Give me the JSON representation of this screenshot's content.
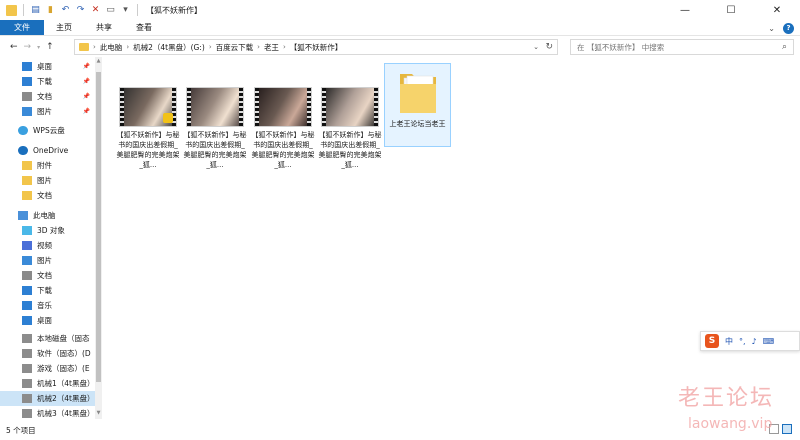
{
  "window": {
    "title": "【狐不妖新作】",
    "controls": {
      "minimize": "—",
      "maximize": "☐",
      "close": "✕"
    }
  },
  "ribbon": {
    "tabs": [
      "文件",
      "主页",
      "共享",
      "查看"
    ],
    "file_color": "#1a6fbd"
  },
  "address": {
    "crumbs": [
      "此电脑",
      "机械2（4t黑盘）(G:)",
      "百度云下载",
      "老王",
      "【狐不妖新作】"
    ],
    "search_placeholder": "在 【狐不妖新作】 中搜索"
  },
  "sidebar": {
    "items": [
      {
        "label": "桌面",
        "icon": "desktop-icon",
        "pinned": true
      },
      {
        "label": "下载",
        "icon": "download-icon",
        "pinned": true
      },
      {
        "label": "文档",
        "icon": "documents-icon",
        "pinned": true
      },
      {
        "label": "图片",
        "icon": "pictures-icon",
        "pinned": true
      },
      {
        "label": "WPS云盘",
        "icon": "cloud-icon"
      },
      {
        "label": "OneDrive",
        "icon": "onedrive-icon"
      },
      {
        "label": "附件",
        "icon": "folder-icon"
      },
      {
        "label": "图片",
        "icon": "folder-icon"
      },
      {
        "label": "文档",
        "icon": "folder-icon"
      },
      {
        "label": "此电脑",
        "icon": "computer-icon"
      },
      {
        "label": "3D 对象",
        "icon": "3d-objects-icon"
      },
      {
        "label": "视频",
        "icon": "videos-icon"
      },
      {
        "label": "图片",
        "icon": "pictures-icon"
      },
      {
        "label": "文档",
        "icon": "documents-icon"
      },
      {
        "label": "下载",
        "icon": "download-icon"
      },
      {
        "label": "音乐",
        "icon": "music-icon"
      },
      {
        "label": "桌面",
        "icon": "desktop-icon"
      },
      {
        "label": "本地磁盘（固态",
        "icon": "drive-icon"
      },
      {
        "label": "软件（固态）(D",
        "icon": "drive-icon"
      },
      {
        "label": "游戏（固态）(E",
        "icon": "drive-icon"
      },
      {
        "label": "机械1（4t黑盘）",
        "icon": "drive-icon"
      },
      {
        "label": "机械2（4t黑盘）",
        "icon": "drive-icon",
        "selected": true
      },
      {
        "label": "机械3（4t黑盘）",
        "icon": "drive-icon"
      }
    ]
  },
  "files": [
    {
      "name": "【狐不妖新作】与秘书的国庆出差假期_美腿肥臀的完美炮架_狐...",
      "type": "video",
      "thumb_colors": [
        "#2a2a2a",
        "#7a6a60",
        "#e8d8c8"
      ],
      "badge": true
    },
    {
      "name": "【狐不妖新作】与秘书的国庆出差假期_美腿肥臀的完美炮架_狐...",
      "type": "video",
      "thumb_colors": [
        "#3a3030",
        "#9a8a80",
        "#f0e0d0"
      ]
    },
    {
      "name": "【狐不妖新作】与秘书的国庆出差假期_美腿肥臀的完美炮架_狐...",
      "type": "video",
      "thumb_colors": [
        "#201818",
        "#6a5a52",
        "#caa898"
      ]
    },
    {
      "name": "【狐不妖新作】与秘书的国庆出差假期_美腿肥臀的完美炮架_狐...",
      "type": "video",
      "thumb_colors": [
        "#1a1a1a",
        "#b0a098",
        "#e8d4c4"
      ]
    }
  ],
  "folder": {
    "name": "上老王论坛当老王",
    "type": "folder"
  },
  "status": {
    "count_text": "5 个项目"
  },
  "ime": {
    "logo": "S",
    "lang": "中",
    "punct": "°,",
    "mic": "🎤",
    "keyboard": "⌨"
  },
  "watermark": {
    "cn": "老王论坛",
    "en": "laowang.vip"
  }
}
